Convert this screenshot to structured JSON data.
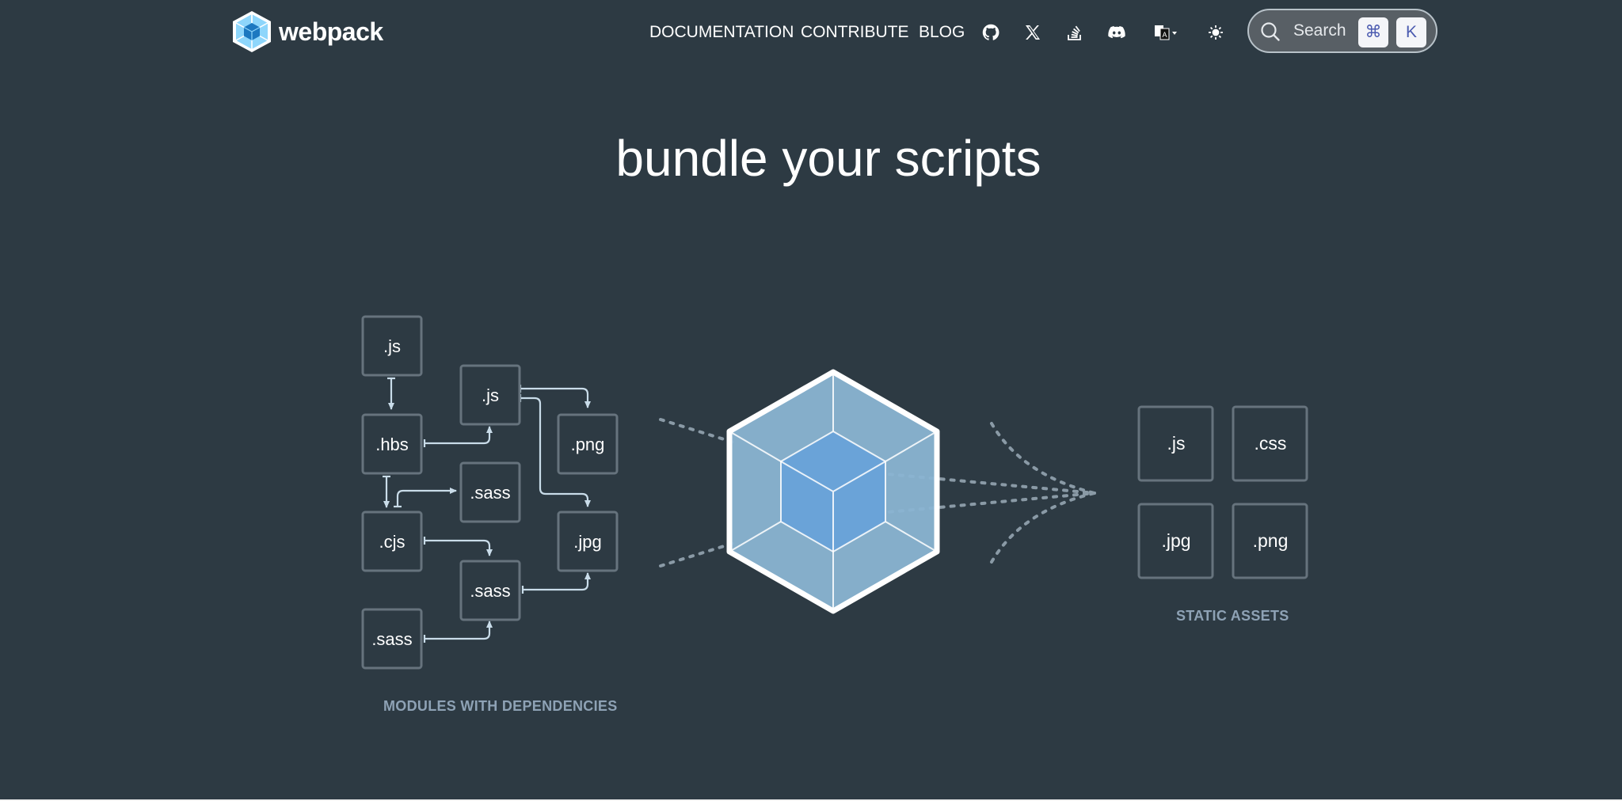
{
  "header": {
    "logo_text": "webpack",
    "nav": [
      {
        "label": "DOCUMENTATION"
      },
      {
        "label": "CONTRIBUTE"
      },
      {
        "label": "BLOG"
      }
    ],
    "icons": [
      "github-icon",
      "x-icon",
      "stack-overflow-icon",
      "discord-icon",
      "language-icon",
      "theme-toggle-icon"
    ],
    "search": {
      "placeholder": "Search",
      "shortcut_mod": "⌘",
      "shortcut_key": "K"
    }
  },
  "hero": {
    "title": "bundle your scripts"
  },
  "diagram": {
    "modules_caption": "MODULES WITH DEPENDENCIES",
    "assets_caption": "STATIC ASSETS",
    "modules": [
      ".js",
      ".hbs",
      ".cjs",
      ".sass",
      ".js",
      ".sass",
      ".sass",
      ".png",
      ".jpg"
    ],
    "assets": [
      ".js",
      ".css",
      ".jpg",
      ".png"
    ]
  },
  "colors": {
    "background": "#2d3a43",
    "box_border": "#66737d",
    "arrow": "#c9dce9",
    "cube_outer": "#8ab4d2",
    "cube_inner": "#6aa3d8",
    "caption": "#8ea2b5"
  }
}
